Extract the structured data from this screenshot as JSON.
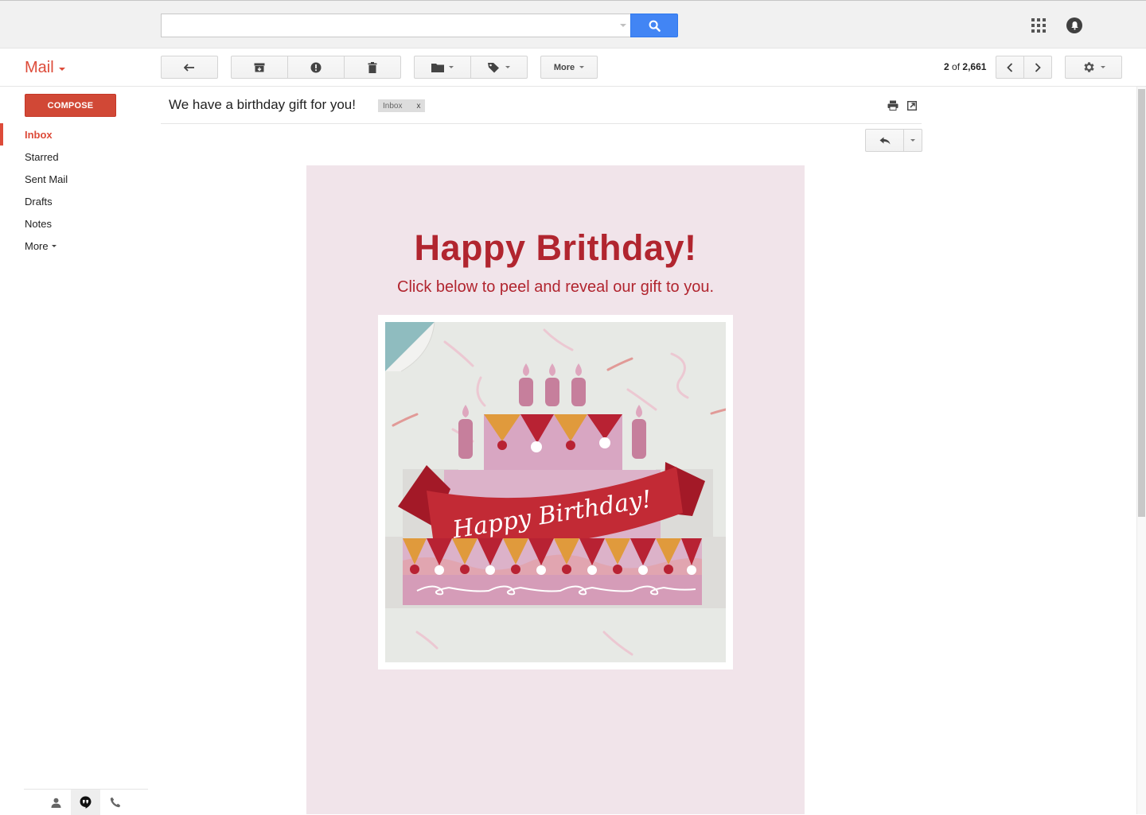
{
  "header": {
    "search_value": "",
    "search_placeholder": ""
  },
  "toolbar": {
    "app_label": "Mail",
    "more_label": "More",
    "pager_current": "2",
    "pager_of": "of",
    "pager_total": "2,661"
  },
  "sidebar": {
    "compose_label": "COMPOSE",
    "items": [
      {
        "label": "Inbox",
        "active": true
      },
      {
        "label": "Starred"
      },
      {
        "label": "Sent Mail"
      },
      {
        "label": "Drafts"
      },
      {
        "label": "Notes"
      },
      {
        "label": "More"
      }
    ]
  },
  "message": {
    "subject": "We have a birthday gift for you!",
    "label": "Inbox",
    "label_remove": "x"
  },
  "email": {
    "title": "Happy Brithday!",
    "subtitle": "Click below to peel and reveal our gift to you.",
    "banner_text": "Happy Birthday!"
  },
  "colors": {
    "accent_red": "#dd4b39",
    "search_blue": "#4285f4",
    "email_bg": "#f1e4ea",
    "email_text": "#b1252f"
  }
}
